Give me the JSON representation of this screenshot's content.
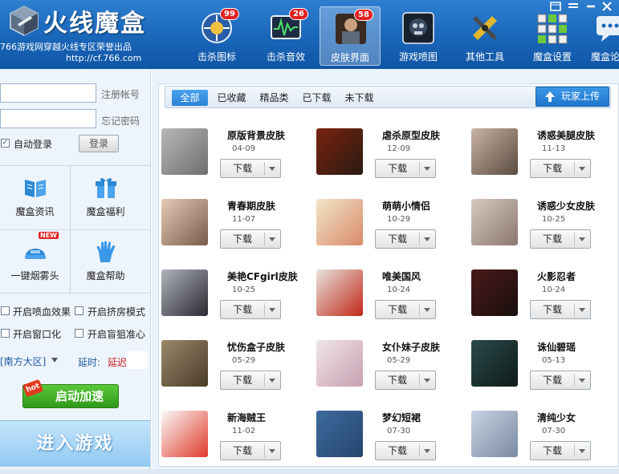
{
  "header": {
    "title": "火线魔盒",
    "subtitle": "766游戏网穿越火线专区荣誉出品",
    "url": "http://cf.766.com",
    "nav": [
      {
        "label": "击杀图标",
        "badge": "99",
        "icon": "kill-icon-icon",
        "active": false
      },
      {
        "label": "击杀音效",
        "badge": "26",
        "icon": "kill-sound-icon",
        "active": false
      },
      {
        "label": "皮肤界面",
        "badge": "58",
        "icon": "skin-icon",
        "active": true
      },
      {
        "label": "游戏喷图",
        "badge": "",
        "icon": "spray-icon",
        "active": false
      },
      {
        "label": "其他工具",
        "badge": "",
        "icon": "tools-icon",
        "active": false
      },
      {
        "label": "魔盒设置",
        "badge": "",
        "icon": "settings-icon",
        "active": false
      },
      {
        "label": "魔盒论坛",
        "badge": "",
        "icon": "forum-icon",
        "active": false
      }
    ]
  },
  "login": {
    "register_link": "注册帐号",
    "forgot_link": "忘记密码",
    "auto_login": "自动登录",
    "auto_login_checked": true,
    "login_button": "登录"
  },
  "quick_grid": [
    {
      "label": "魔盒资讯",
      "icon": "book-icon"
    },
    {
      "label": "魔盒福利",
      "icon": "gift-icon"
    },
    {
      "label": "一键烟雾头",
      "icon": "helmet-icon",
      "badge": "NEW"
    },
    {
      "label": "魔盒帮助",
      "icon": "hand-icon"
    }
  ],
  "options": [
    {
      "label": "开启喷血效果",
      "checked": false
    },
    {
      "label": "开启挤房模式",
      "checked": false
    },
    {
      "label": "开启窗口化",
      "checked": false
    },
    {
      "label": "开启盲狙准心",
      "checked": false
    }
  ],
  "region": {
    "server": "[南方大区]",
    "delay_label": "延时:",
    "delay_value": "延迟"
  },
  "start_button": {
    "label": "启动加速",
    "badge": "hot"
  },
  "enter_button": "进入游戏",
  "tabs": [
    "全部",
    "已收藏",
    "精品类",
    "已下载",
    "未下载"
  ],
  "active_tab": "全部",
  "upload_button": "玩家上传",
  "download_label": "下载",
  "skins": [
    {
      "name": "原版背景皮肤",
      "date": "04-09",
      "colors": [
        "#b8b8b8",
        "#6e6e6e"
      ]
    },
    {
      "name": "虐杀原型皮肤",
      "date": "12-09",
      "colors": [
        "#7a2410",
        "#2a1a12"
      ]
    },
    {
      "name": "诱惑美腿皮肤",
      "date": "11-13",
      "colors": [
        "#c9b3a3",
        "#5a4a40"
      ]
    },
    {
      "name": "青春期皮肤",
      "date": "11-07",
      "colors": [
        "#e6cbb8",
        "#7a5a48"
      ]
    },
    {
      "name": "萌萌小情侣",
      "date": "10-29",
      "colors": [
        "#f3e6c8",
        "#d88a6a"
      ]
    },
    {
      "name": "诱惑少女皮肤",
      "date": "10-25",
      "colors": [
        "#d8c8c0",
        "#8a7870"
      ]
    },
    {
      "name": "美艳CFgirl皮肤",
      "date": "10-25",
      "colors": [
        "#b0b4bc",
        "#2a2a30"
      ]
    },
    {
      "name": "唯美国风",
      "date": "10-24",
      "colors": [
        "#e8e4dc",
        "#c02818"
      ]
    },
    {
      "name": "火影忍者",
      "date": "10-24",
      "colors": [
        "#4a1a1a",
        "#1a0e0e"
      ]
    },
    {
      "name": "忧伤盒子皮肤",
      "date": "05-29",
      "colors": [
        "#9a8a6a",
        "#4a3a2a"
      ]
    },
    {
      "name": "女仆妹子皮肤",
      "date": "05-29",
      "colors": [
        "#f0e4ea",
        "#c8a0b0"
      ]
    },
    {
      "name": "诛仙碧瑶",
      "date": "05-13",
      "colors": [
        "#2a4a48",
        "#0e1a1a"
      ]
    },
    {
      "name": "新海贼王",
      "date": "11-02",
      "colors": [
        "#fafafa",
        "#e03a2a"
      ]
    },
    {
      "name": "梦幻短裙",
      "date": "07-30",
      "colors": [
        "#3f6a9e",
        "#24466e"
      ]
    },
    {
      "name": "清纯少女",
      "date": "07-30",
      "colors": [
        "#c8d4e4",
        "#7a8aa0"
      ]
    }
  ],
  "accent_color": "#1a66b8"
}
